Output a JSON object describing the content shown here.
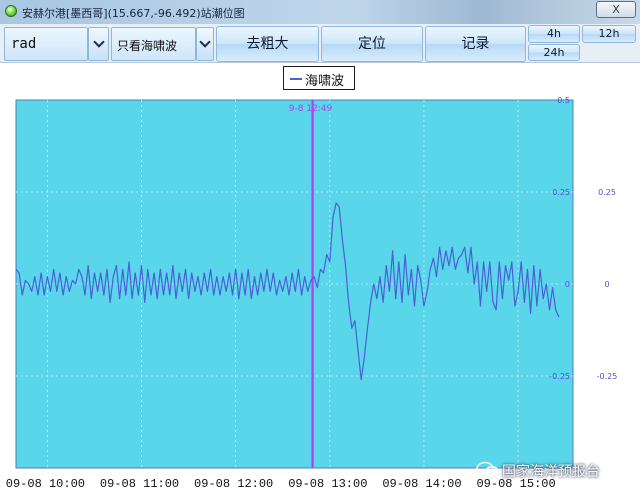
{
  "window": {
    "title": "安赫尔港[墨西哥](15.667,-96.492)站潮位图",
    "close_label": "X"
  },
  "toolbar": {
    "unit_value": "rad",
    "filter_value": "只看海啸波",
    "detrend_label": "去粗大",
    "locate_label": "定位",
    "record_label": "记录",
    "range_4h": "4h",
    "range_12h": "12h",
    "range_24h": "24h"
  },
  "legend": {
    "series_label": "海啸波"
  },
  "marker": {
    "label": "9-8 12:49"
  },
  "watermark": {
    "text": "国家海洋预报台"
  },
  "colors": {
    "plot_bg": "#5ad6ea",
    "series": "#4b5fd6",
    "marker": "#b43cf2",
    "axis_text": "#4b4fd8"
  },
  "chart_data": {
    "type": "line",
    "title": "",
    "xlabel": "",
    "ylabel": "",
    "ylim": [
      -0.5,
      0.5
    ],
    "xlim": [
      "09-08 09:40",
      "09-08 15:35"
    ],
    "y_ticks": [
      "0.5",
      "0.25",
      "0",
      "-0.25"
    ],
    "y_tick_values": [
      0.5,
      0.25,
      0,
      -0.25
    ],
    "x_ticks": [
      "09-08 10:00",
      "09-08 11:00",
      "09-08 12:00",
      "09-08 13:00",
      "09-08 14:00",
      "09-08 15:00"
    ],
    "x_tick_minutes": [
      600,
      660,
      720,
      780,
      840,
      900
    ],
    "grid": true,
    "legend_position": "top-center",
    "marker_minute": 769,
    "series": [
      {
        "name": "海啸波",
        "x_minutes": [
          580,
          582,
          584,
          586,
          588,
          590,
          592,
          594,
          596,
          598,
          600,
          602,
          604,
          606,
          608,
          610,
          612,
          614,
          616,
          618,
          620,
          622,
          624,
          626,
          628,
          630,
          632,
          634,
          636,
          638,
          640,
          642,
          644,
          646,
          648,
          650,
          652,
          654,
          656,
          658,
          660,
          662,
          664,
          666,
          668,
          670,
          672,
          674,
          676,
          678,
          680,
          682,
          684,
          686,
          688,
          690,
          692,
          694,
          696,
          698,
          700,
          702,
          704,
          706,
          708,
          710,
          712,
          714,
          716,
          718,
          720,
          722,
          724,
          726,
          728,
          730,
          732,
          734,
          736,
          738,
          740,
          742,
          744,
          746,
          748,
          750,
          752,
          754,
          756,
          758,
          760,
          762,
          764,
          766,
          768,
          770,
          772,
          774,
          776,
          778,
          780,
          782,
          784,
          786,
          788,
          790,
          792,
          794,
          796,
          798,
          800,
          802,
          804,
          806,
          808,
          810,
          812,
          814,
          816,
          818,
          820,
          822,
          824,
          826,
          828,
          830,
          832,
          834,
          836,
          838,
          840,
          842,
          844,
          846,
          848,
          850,
          852,
          854,
          856,
          858,
          860,
          862,
          864,
          866,
          868,
          870,
          872,
          874,
          876,
          878,
          880,
          882,
          884,
          886,
          888,
          890,
          892,
          894,
          896,
          898,
          900,
          902,
          904,
          906,
          908,
          910,
          912,
          914,
          916,
          918,
          920,
          922,
          924,
          926,
          928,
          930,
          932,
          934,
          936,
          938,
          940,
          942,
          944,
          946,
          948
        ],
        "values": [
          0.04,
          0.03,
          -0.03,
          0.01,
          0.0,
          -0.02,
          0.02,
          -0.03,
          0.03,
          -0.03,
          0.02,
          -0.02,
          0.04,
          -0.02,
          0.03,
          -0.03,
          0.02,
          -0.02,
          0.01,
          0.0,
          0.04,
          0.02,
          -0.03,
          0.05,
          -0.04,
          0.03,
          -0.02,
          0.03,
          -0.03,
          0.04,
          -0.05,
          0.02,
          0.05,
          -0.04,
          0.04,
          -0.03,
          0.06,
          -0.04,
          0.03,
          -0.03,
          0.05,
          -0.05,
          0.04,
          -0.03,
          0.03,
          -0.04,
          0.04,
          -0.03,
          0.03,
          -0.03,
          0.05,
          -0.04,
          0.03,
          -0.02,
          0.04,
          -0.04,
          0.03,
          -0.02,
          0.02,
          -0.03,
          0.03,
          -0.02,
          0.04,
          -0.03,
          0.02,
          -0.03,
          0.02,
          -0.02,
          0.03,
          -0.03,
          0.04,
          -0.04,
          0.03,
          -0.03,
          0.04,
          -0.04,
          0.02,
          -0.03,
          0.03,
          -0.02,
          0.04,
          -0.02,
          0.03,
          -0.03,
          0.01,
          -0.02,
          0.02,
          -0.03,
          0.03,
          -0.02,
          0.04,
          -0.03,
          0.02,
          -0.02,
          0.01,
          0.02,
          -0.01,
          0.04,
          0.03,
          0.08,
          0.06,
          0.18,
          0.22,
          0.21,
          0.12,
          0.05,
          -0.05,
          -0.12,
          -0.1,
          -0.18,
          -0.26,
          -0.2,
          -0.12,
          -0.05,
          0.0,
          -0.04,
          0.02,
          -0.05,
          0.05,
          -0.02,
          0.09,
          -0.04,
          0.06,
          -0.05,
          0.08,
          -0.03,
          0.04,
          -0.06,
          0.05,
          0.01,
          -0.06,
          -0.02,
          0.04,
          0.07,
          0.02,
          0.1,
          0.04,
          0.09,
          0.05,
          0.1,
          0.04,
          0.07,
          0.08,
          0.1,
          0.03,
          0.1,
          0.0,
          0.06,
          -0.06,
          0.06,
          -0.02,
          0.06,
          -0.05,
          -0.07,
          0.06,
          -0.04,
          0.05,
          0.01,
          0.06,
          -0.06,
          -0.02,
          0.06,
          -0.05,
          0.04,
          -0.08,
          0.05,
          -0.06,
          0.04,
          -0.04,
          0.0,
          -0.07,
          -0.01,
          -0.07,
          -0.09
        ]
      }
    ]
  }
}
